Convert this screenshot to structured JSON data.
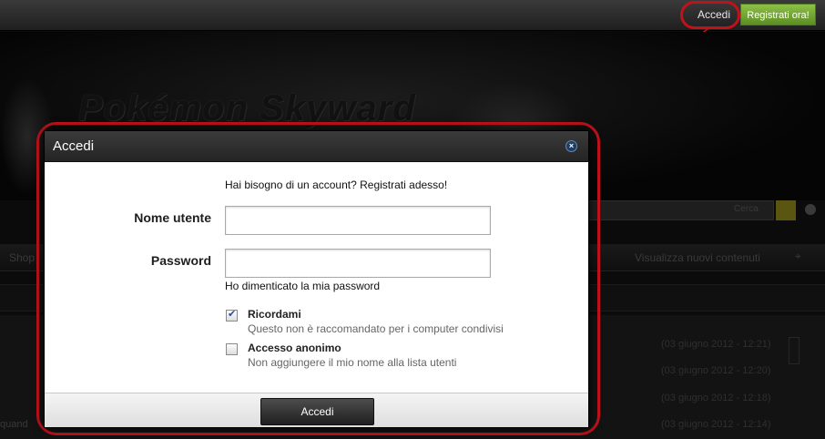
{
  "topbar": {
    "login_label": "Accedi",
    "register_label": "Registrati ora!"
  },
  "banner": {
    "logo_text": "Pokémon Skyward"
  },
  "search": {
    "label": "Cerca"
  },
  "nav": {
    "left_item": "Shop",
    "right_item": "Visualizza nuovi contenuti",
    "pin_icon": "map-pin-icon"
  },
  "background_list": {
    "dates": [
      "(03 giugno 2012 - 12:21)",
      "(03 giugno 2012 - 12:20)",
      "(03 giugno 2012 - 12:18)",
      "(03 giugno 2012 - 12:14)"
    ],
    "side_text": "quand"
  },
  "modal": {
    "title": "Accedi",
    "close_icon": "close-icon",
    "need_account_text": "Hai bisogno di un account?",
    "register_link": "Registrati adesso!",
    "username_label": "Nome utente",
    "username_value": "",
    "password_label": "Password",
    "password_value": "",
    "forgot_link": "Ho dimenticato la mia password",
    "remember": {
      "title": "Ricordami",
      "description": "Questo non è raccomandato per i computer condivisi",
      "checked": true
    },
    "anonymous": {
      "title": "Accesso anonimo",
      "description": "Non aggiungere il mio nome alla lista utenti",
      "checked": false
    },
    "submit_label": "Accedi"
  },
  "colors": {
    "highlight": "#c1121b",
    "register_green": "#6f9f2f",
    "header_dark": "#2b2b2b"
  }
}
